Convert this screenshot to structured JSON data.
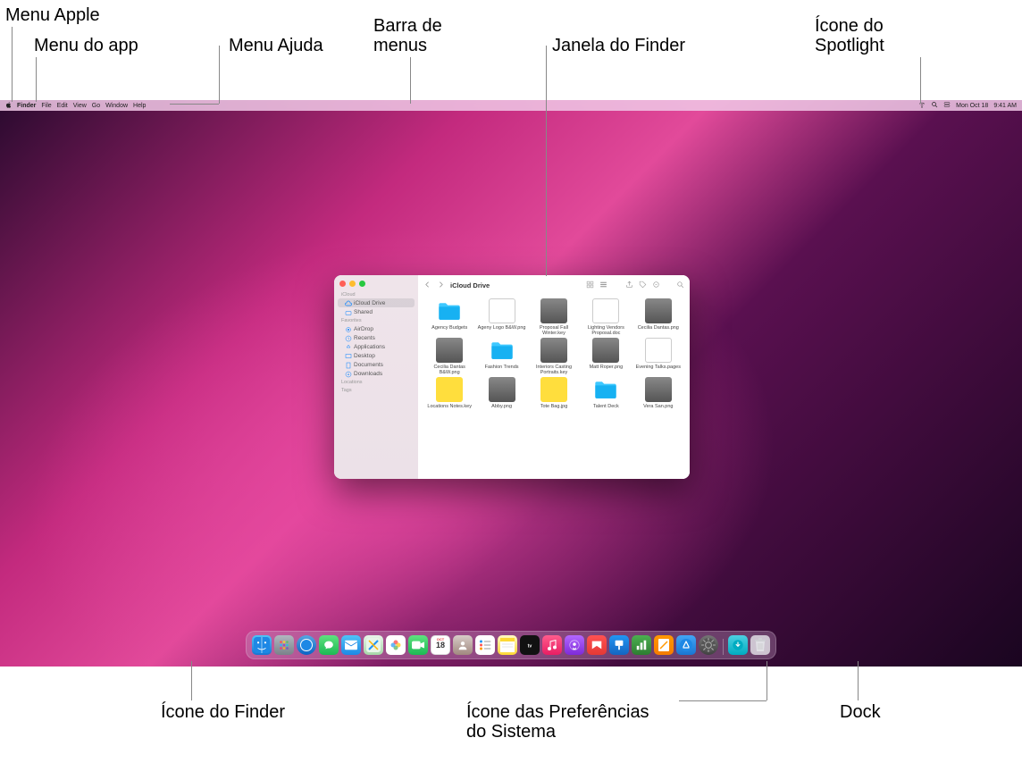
{
  "annotations": {
    "top": {
      "apple_menu": "Menu Apple",
      "app_menu": "Menu do app",
      "help_menu": "Menu Ajuda",
      "menu_bar": "Barra de\nmenus",
      "finder_window": "Janela do Finder",
      "spotlight": "Ícone do\nSpotlight"
    },
    "bottom": {
      "finder_icon": "Ícone do Finder",
      "syspref_icon": "Ícone das Preferências\ndo Sistema",
      "dock": "Dock"
    }
  },
  "menubar": {
    "app_name": "Finder",
    "items": [
      "File",
      "Edit",
      "View",
      "Go",
      "Window",
      "Help"
    ],
    "status_date": "Mon Oct 18",
    "status_time": "9:41 AM"
  },
  "finder": {
    "title": "iCloud Drive",
    "sidebar": {
      "icloud_header": "iCloud",
      "icloud_items": [
        {
          "label": "iCloud Drive",
          "icon": "cloud",
          "selected": true
        },
        {
          "label": "Shared",
          "icon": "shared"
        }
      ],
      "fav_header": "Favorites",
      "fav_items": [
        {
          "label": "AirDrop",
          "icon": "airdrop"
        },
        {
          "label": "Recents",
          "icon": "clock"
        },
        {
          "label": "Applications",
          "icon": "apps"
        },
        {
          "label": "Desktop",
          "icon": "desktop"
        },
        {
          "label": "Documents",
          "icon": "doc"
        },
        {
          "label": "Downloads",
          "icon": "down"
        }
      ],
      "loc_header": "Locations",
      "tags_header": "Tags"
    },
    "files": [
      {
        "name": "Agency Budgets",
        "type": "folder"
      },
      {
        "name": "Ageny Logo B&W.png",
        "type": "doc"
      },
      {
        "name": "Proposal Fall Winter.key",
        "type": "img"
      },
      {
        "name": "Lighting Vendors Proposal.doc",
        "type": "doc"
      },
      {
        "name": "Cecilia Dantas.png",
        "type": "img"
      },
      {
        "name": "Cecilia Dantas B&W.png",
        "type": "img"
      },
      {
        "name": "Fashion Trends",
        "type": "folder"
      },
      {
        "name": "Interiors Casting Portraits.key",
        "type": "img"
      },
      {
        "name": "Matt Roper.png",
        "type": "img"
      },
      {
        "name": "Evening Talks.pages",
        "type": "doc"
      },
      {
        "name": "Locations Notes.key",
        "type": "yellow"
      },
      {
        "name": "Abby.png",
        "type": "img"
      },
      {
        "name": "Tote Bag.jpg",
        "type": "yellow"
      },
      {
        "name": "Talent Deck",
        "type": "folder"
      },
      {
        "name": "Vera San.png",
        "type": "img"
      }
    ]
  },
  "calendar_day": "18",
  "calendar_month": "OCT"
}
